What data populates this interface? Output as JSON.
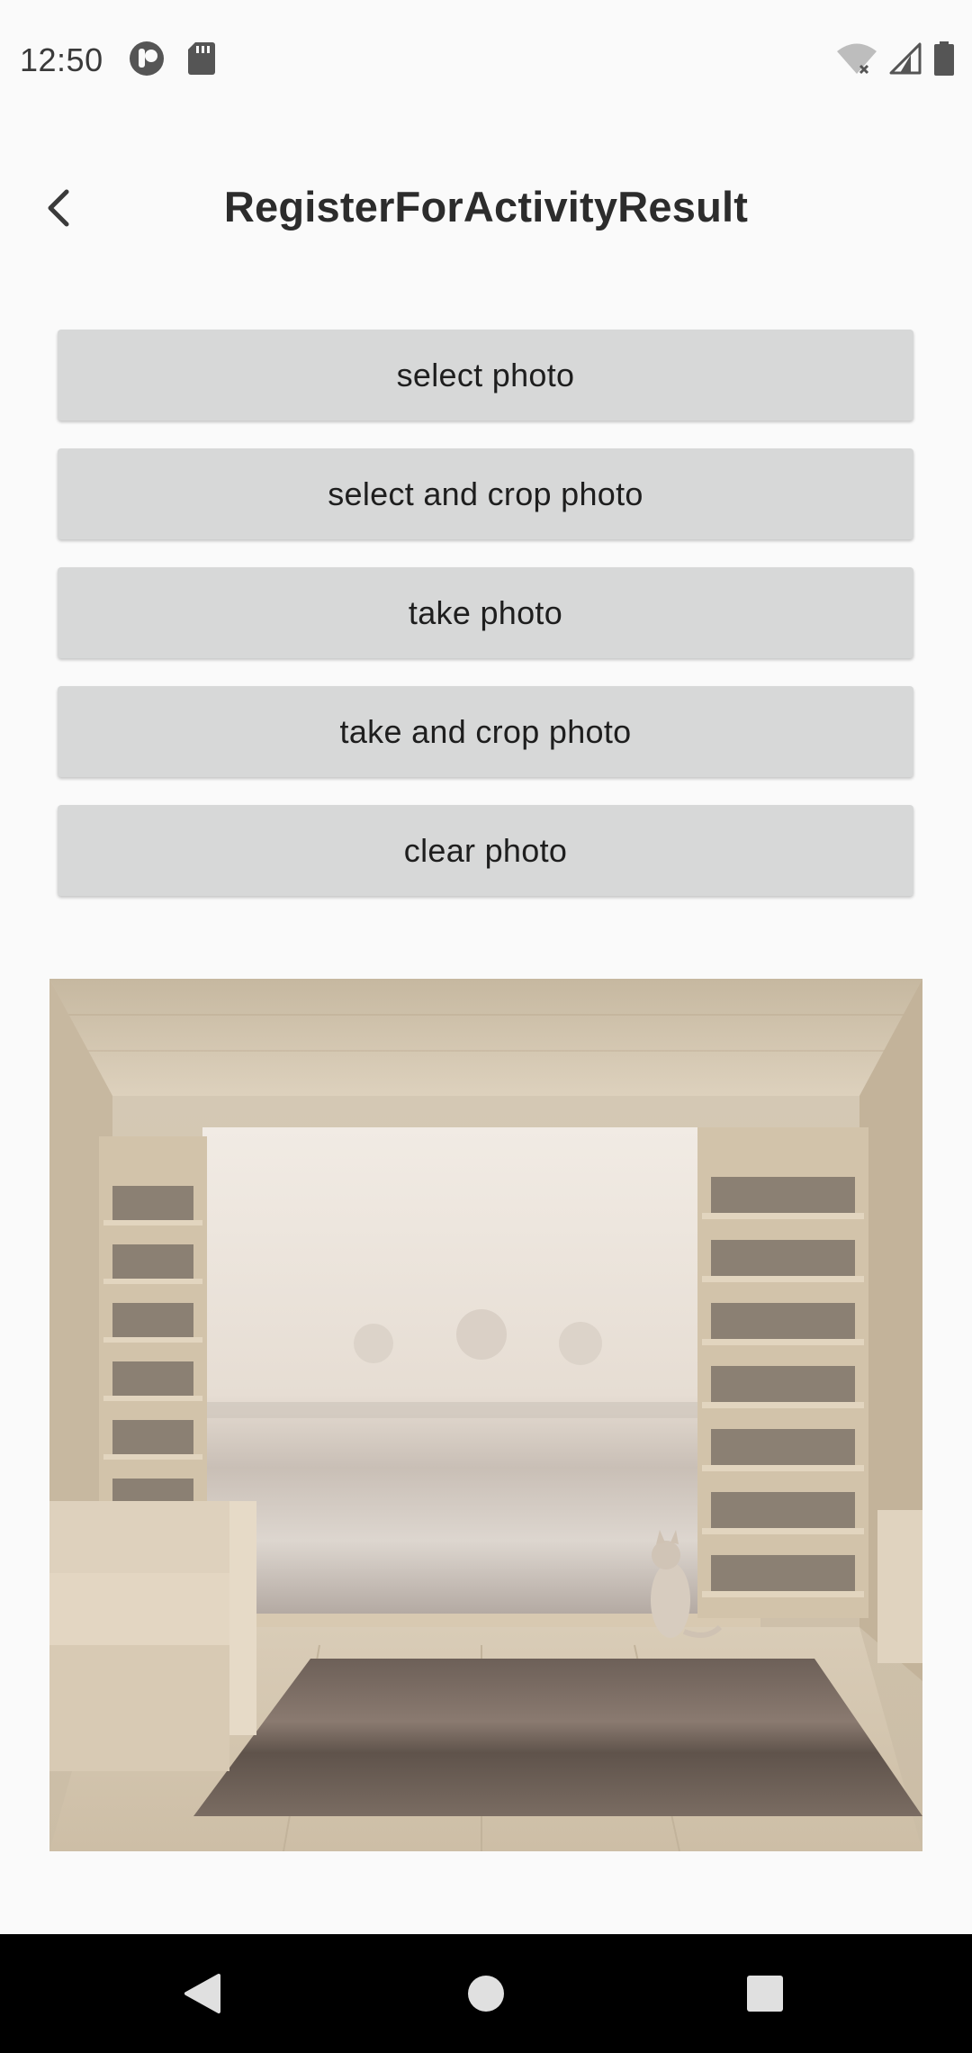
{
  "status_bar": {
    "time": "12:50"
  },
  "toolbar": {
    "title": "RegisterForActivityResult"
  },
  "buttons": {
    "select_photo": "select photo",
    "select_and_crop_photo": "select and crop photo",
    "take_photo": "take photo",
    "take_and_crop_photo": "take and crop photo",
    "clear_photo": "clear photo"
  },
  "photo": {
    "icon": "photo-preview"
  },
  "colors": {
    "background": "#fafafa",
    "button_bg": "#d7d8d8",
    "nav_bar": "#000000"
  }
}
